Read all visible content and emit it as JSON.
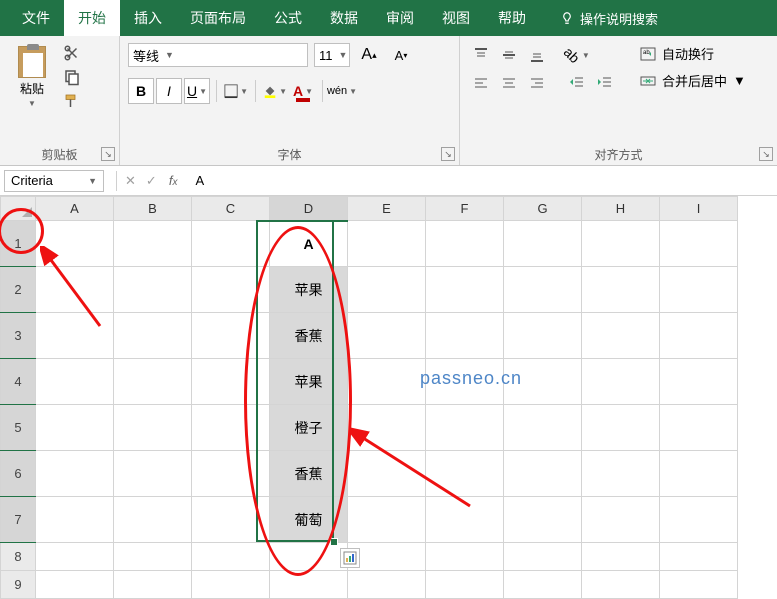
{
  "colors": {
    "brand": "#217346",
    "annotate": "#e11c1c"
  },
  "tabs": [
    "文件",
    "开始",
    "插入",
    "页面布局",
    "公式",
    "数据",
    "审阅",
    "视图",
    "帮助"
  ],
  "active_tab_index": 1,
  "tell_me": "操作说明搜索",
  "ribbon": {
    "clipboard": {
      "paste": "粘贴",
      "label": "剪贴板"
    },
    "font": {
      "family": "等线",
      "size": "11",
      "label": "字体",
      "wen": "wén"
    },
    "alignment": {
      "label": "对齐方式",
      "wrap": "自动换行",
      "merge": "合并后居中"
    }
  },
  "name_box": "Criteria",
  "formula": "A",
  "grid": {
    "columns": [
      "A",
      "B",
      "C",
      "D",
      "E",
      "F",
      "G",
      "H",
      "I"
    ],
    "row_numbers": [
      1,
      2,
      3,
      4,
      5,
      6,
      7,
      8,
      9
    ],
    "d_values": [
      "A",
      "苹果",
      "香蕉",
      "苹果",
      "橙子",
      "香蕉",
      "葡萄"
    ],
    "selection": {
      "col": "D",
      "rows": [
        1,
        7
      ]
    }
  },
  "watermark": "passneo.cn"
}
